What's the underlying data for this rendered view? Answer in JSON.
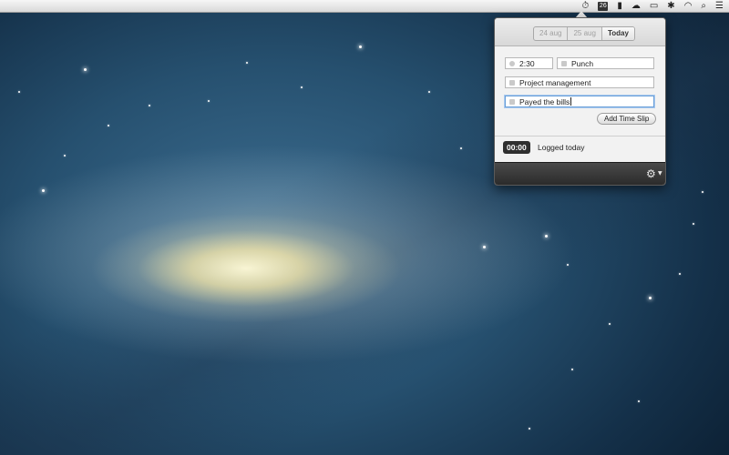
{
  "menubar": {
    "icons": [
      "timer-icon",
      "calendar-icon",
      "bookmark-icon",
      "cloud-icon",
      "battery-icon",
      "bluetooth-icon",
      "wifi-icon",
      "spotlight-search-icon",
      "notification-list-icon"
    ],
    "calendar_day": "26"
  },
  "popover": {
    "date_tabs": [
      {
        "label": "24 aug",
        "active": false
      },
      {
        "label": "25 aug",
        "active": false
      },
      {
        "label": "Today",
        "active": true
      }
    ],
    "duration_value": "2:30",
    "task_value": "Punch",
    "project_value": "Project management",
    "note_value": "Payed the bills",
    "add_button_label": "Add Time Slip",
    "logged_time": "00:00",
    "logged_label": "Logged today"
  }
}
